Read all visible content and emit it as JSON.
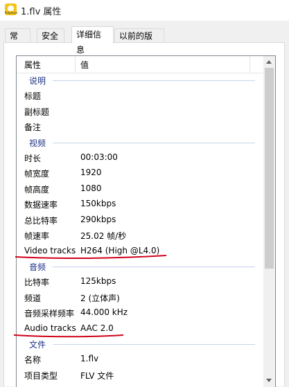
{
  "window": {
    "title": "1.flv 属性",
    "icon_label": "Potplayer"
  },
  "tabs": [
    {
      "label": "常规"
    },
    {
      "label": "安全"
    },
    {
      "label": "详细信息"
    },
    {
      "label": "以前的版本"
    }
  ],
  "active_tab": "详细信息",
  "table": {
    "header": {
      "property": "属性",
      "value": "值"
    },
    "groups": [
      {
        "name": "说明",
        "rows": [
          {
            "p": "标题",
            "v": ""
          },
          {
            "p": "副标题",
            "v": ""
          },
          {
            "p": "备注",
            "v": ""
          }
        ]
      },
      {
        "name": "视频",
        "rows": [
          {
            "p": "时长",
            "v": "00:03:00"
          },
          {
            "p": "帧宽度",
            "v": "1920"
          },
          {
            "p": "帧高度",
            "v": "1080"
          },
          {
            "p": "数据速率",
            "v": "150kbps"
          },
          {
            "p": "总比特率",
            "v": "290kbps"
          },
          {
            "p": "帧速率",
            "v": "25.02 帧/秒"
          },
          {
            "p": "Video tracks",
            "v": "H264 (High @L4.0)"
          }
        ]
      },
      {
        "name": "音频",
        "rows": [
          {
            "p": "比特率",
            "v": "125kbps"
          },
          {
            "p": "频道",
            "v": "2 (立体声)"
          },
          {
            "p": "音频采样频率",
            "v": "44.000 kHz"
          },
          {
            "p": "Audio tracks",
            "v": "AAC 2.0"
          }
        ]
      },
      {
        "name": "文件",
        "rows": [
          {
            "p": "名称",
            "v": "1.flv"
          },
          {
            "p": "项目类型",
            "v": "FLV 文件"
          }
        ]
      }
    ]
  },
  "colors": {
    "group_header": "#1e3287",
    "annotation_red": "#d0021b",
    "scroll_thumb": "#cdcdcd"
  }
}
